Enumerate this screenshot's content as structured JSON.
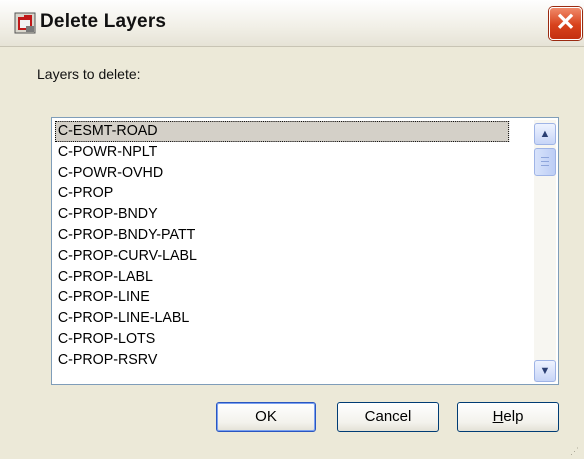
{
  "window": {
    "title": "Delete Layers",
    "close_glyph": "✕",
    "app_icon": "autocad-icon"
  },
  "section_label": "Layers to delete:",
  "layers": [
    "C-ESMT-ROAD",
    "C-POWR-NPLT",
    "C-POWR-OVHD",
    "C-PROP",
    "C-PROP-BNDY",
    "C-PROP-BNDY-PATT",
    "C-PROP-CURV-LABL",
    "C-PROP-LABL",
    "C-PROP-LINE",
    "C-PROP-LINE-LABL",
    "C-PROP-LOTS",
    "C-PROP-RSRV"
  ],
  "selected_layer": "C-ESMT-ROAD",
  "scrollbar": {
    "up_glyph": "▲",
    "down_glyph": "▼"
  },
  "buttons": {
    "ok": "OK",
    "cancel": "Cancel",
    "help_prefix": "H",
    "help_rest": "elp"
  }
}
